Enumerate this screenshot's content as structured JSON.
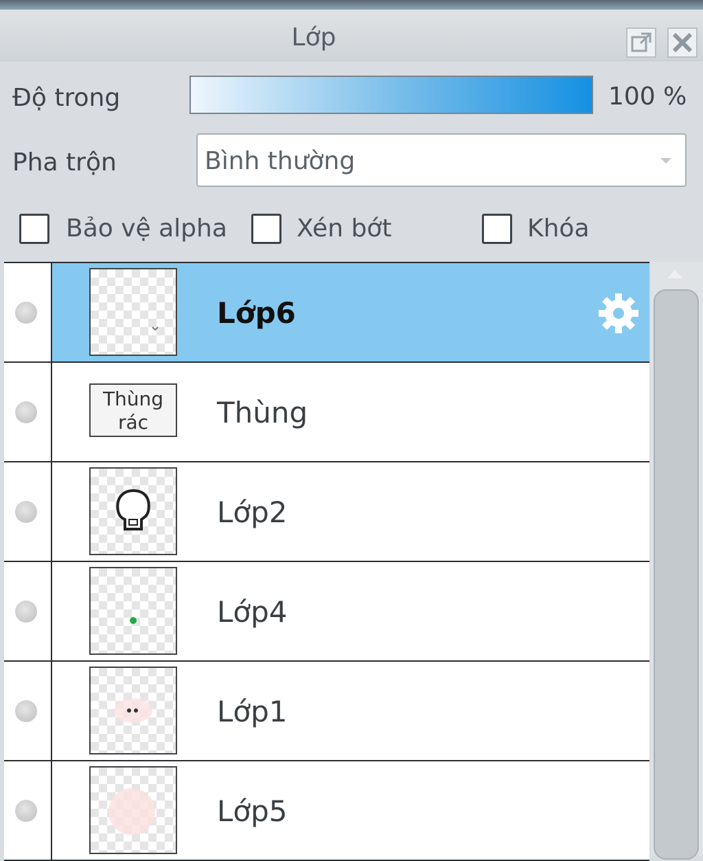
{
  "panel": {
    "title": "Lớp"
  },
  "opacity": {
    "label": "Độ trong",
    "value": 100,
    "value_text": "100 %"
  },
  "blend": {
    "label": "Pha trộn",
    "selected": "Bình thường"
  },
  "options": [
    {
      "label": "Bảo vệ alpha",
      "checked": false
    },
    {
      "label": "Xén bớt",
      "checked": false
    },
    {
      "label": "Khóa",
      "checked": false
    }
  ],
  "layers": [
    {
      "name": "Lớp6",
      "selected": true,
      "thumb": "transparent"
    },
    {
      "name": "Thùng",
      "selected": false,
      "thumb": "text",
      "thumb_text": "Thùng rác"
    },
    {
      "name": "Lớp2",
      "selected": false,
      "thumb": "skull"
    },
    {
      "name": "Lớp4",
      "selected": false,
      "thumb": "green-dot"
    },
    {
      "name": "Lớp1",
      "selected": false,
      "thumb": "face"
    },
    {
      "name": "Lớp5",
      "selected": false,
      "thumb": "pink-circle"
    }
  ],
  "colors": {
    "selected_row": "#85c9f1",
    "opacity_fill": "#1590e2"
  }
}
